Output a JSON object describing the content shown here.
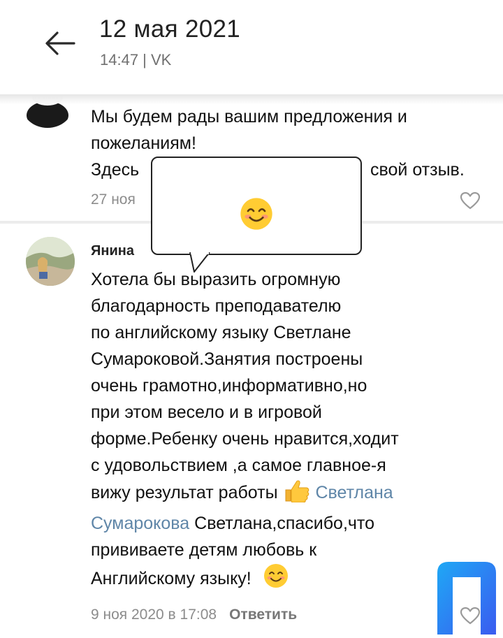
{
  "header": {
    "date": "12 мая 2021",
    "meta": "14:47 | VK"
  },
  "comment1": {
    "line1": "Мы будем рады вашим предложения и",
    "line2": "пожеланиям!",
    "line3_start": "Здесь",
    "line3_end": "свой отзыв.",
    "date_partial": "27 ноя"
  },
  "comment2": {
    "author": "Янина",
    "lines": [
      "Хотела бы выразить огромную",
      "благодарность преподавателю",
      "по английскому языку Светлане",
      "Сумароковой.Занятия построены",
      "очень грамотно,информативно,но",
      "при этом весело и в игровой",
      "форме.Ребенку очень нравится,ходит",
      "с удовольствием ,а самое главное-я"
    ],
    "line9_text": "вижу результат работы",
    "link_part1": "Светлана",
    "link_part2": "Сумарокова",
    "line10_rest": " Светлана,спасибо,что",
    "line11": "прививаете детям любовь к",
    "line12": "Английскому языку!",
    "date": "9 ноя 2020 в 17:08",
    "reply": "Ответить"
  },
  "icons": {
    "back": "arrow-left-icon",
    "like": "heart-outline-icon",
    "smile": "smiling-face-emoji",
    "thumbs": "thumbs-up-emoji"
  },
  "colors": {
    "link": "#5f86a8",
    "meta": "#8c8c8c",
    "logo_start": "#1fa8f5",
    "logo_end": "#3a5bf0"
  }
}
